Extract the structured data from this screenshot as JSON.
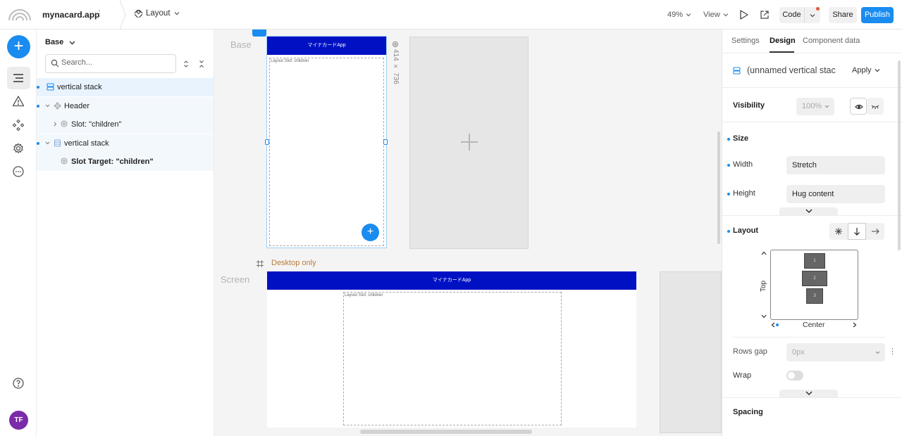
{
  "app": {
    "name": "mynacard.app",
    "layout_label": "Layout"
  },
  "toolbar": {
    "zoom": "49%",
    "view_label": "View",
    "code_label": "Code",
    "share_label": "Share",
    "publish_label": "Publish",
    "accent": "#1a8cf0"
  },
  "rail": {
    "avatar_initials": "TF",
    "avatar_color": "#7b2aa9"
  },
  "layers": {
    "breakpoint": "Base",
    "search_placeholder": "Search...",
    "items": [
      {
        "label": "vertical stack",
        "icon": "vertical-stack-icon",
        "selected": true
      },
      {
        "label": "Header",
        "icon": "component-icon"
      },
      {
        "label": "Slot: \"children\"",
        "icon": "slot-icon"
      },
      {
        "label": "vertical stack",
        "icon": "vertical-stack-icon"
      },
      {
        "label": "Slot Target: \"children\"",
        "icon": "slot-icon"
      }
    ]
  },
  "canvas": {
    "base_label": "Base",
    "screen_label": "Screen",
    "header_text": "マイナカードApp",
    "slot_text": "Layout Slot: children",
    "size_readout": "414 × 736",
    "desktop_label": "Desktop only"
  },
  "props": {
    "tabs": [
      "Settings",
      "Design",
      "Component data"
    ],
    "active_tab": "Design",
    "component_name": "(unnamed vertical stac",
    "apply_label": "Apply",
    "visibility": {
      "title": "Visibility",
      "value": "100%"
    },
    "size": {
      "title": "Size",
      "width_label": "Width",
      "width_value": "Stretch",
      "height_label": "Height",
      "height_value": "Hug content"
    },
    "layout": {
      "title": "Layout",
      "axis_label": "Top",
      "align_label": "Center",
      "boxes": [
        "1",
        "2",
        "3"
      ],
      "rows_gap_label": "Rows gap",
      "rows_gap_value": "0px",
      "wrap_label": "Wrap"
    },
    "spacing_title": "Spacing"
  }
}
